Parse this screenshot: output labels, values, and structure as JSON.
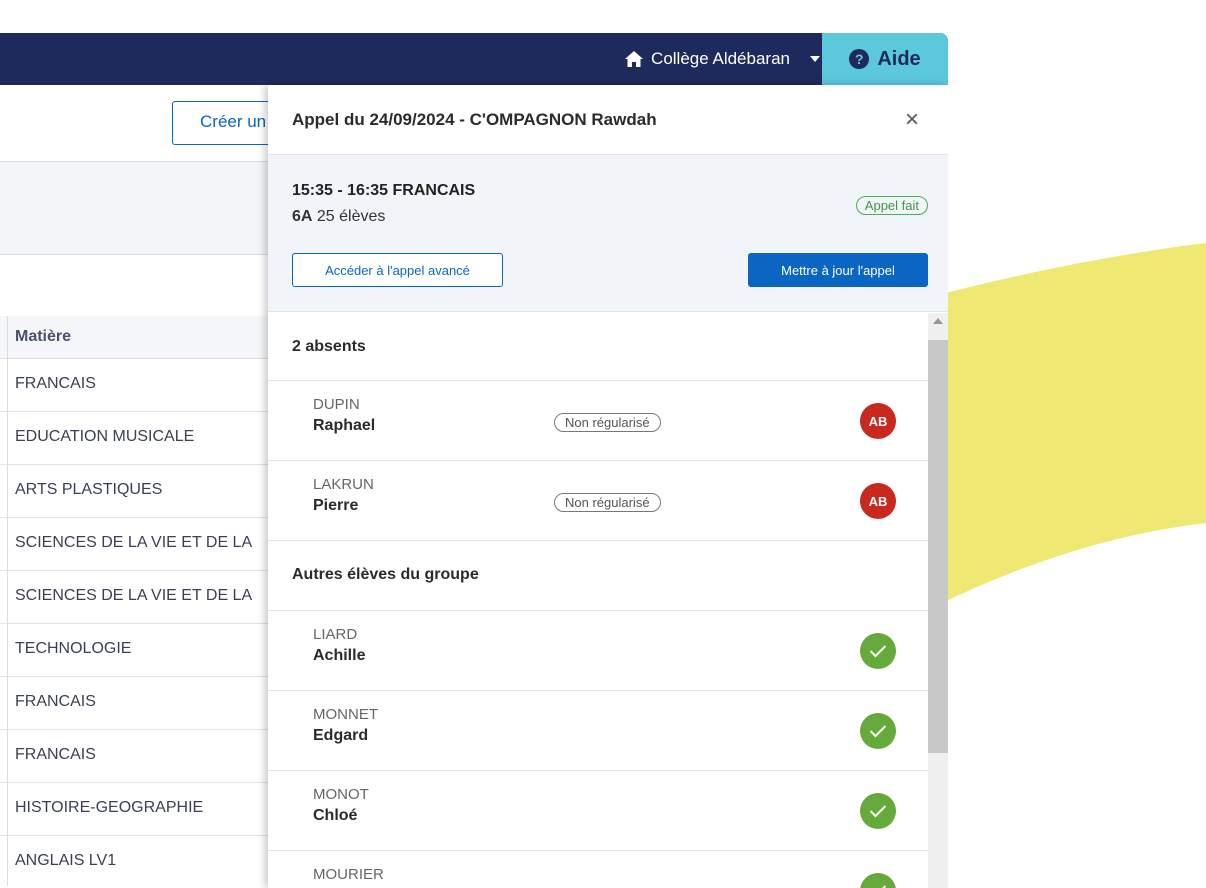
{
  "header": {
    "school_name": "Collège Aldébaran",
    "help_label": "Aide",
    "help_glyph": "?"
  },
  "background_page": {
    "create_button_label": "Créer un",
    "table": {
      "column_header": "Matière",
      "rows": [
        "FRANCAIS",
        "EDUCATION MUSICALE",
        "ARTS PLASTIQUES",
        "SCIENCES DE LA VIE ET DE LA",
        "SCIENCES DE LA VIE ET DE LA",
        "TECHNOLOGIE",
        "FRANCAIS",
        "FRANCAIS",
        "HISTOIRE-GEOGRAPHIE",
        "ANGLAIS LV1"
      ]
    }
  },
  "panel": {
    "title": "Appel du 24/09/2024 - C'OMPAGNON Rawdah",
    "close_glyph": "×",
    "course": {
      "time_subject": "15:35 - 16:35 FRANCAIS",
      "class_name": "6A",
      "student_count": "25 élèves",
      "status_badge": "Appel fait",
      "advanced_button": "Accéder à l'appel avancé",
      "update_button": "Mettre à jour l'appel"
    },
    "absents_title": "2 absents",
    "absents": [
      {
        "last_name": "DUPIN",
        "first_name": "Raphael",
        "status": "Non régularisé",
        "badge": "AB"
      },
      {
        "last_name": "LAKRUN",
        "first_name": "Pierre",
        "status": "Non régularisé",
        "badge": "AB"
      }
    ],
    "others_title": "Autres élèves du groupe",
    "others": [
      {
        "last_name": "LIARD",
        "first_name": "Achille"
      },
      {
        "last_name": "MONNET",
        "first_name": "Edgard"
      },
      {
        "last_name": "MONOT",
        "first_name": "Chloé"
      },
      {
        "last_name": "MOURIER",
        "first_name": ""
      }
    ]
  },
  "colors": {
    "topbar": "#1f2a5c",
    "help_bg": "#5cc8dc",
    "primary": "#0a66c2",
    "absent_badge": "#c8281e",
    "present_badge": "#66aa3c",
    "decor_yellow": "#efe873"
  }
}
